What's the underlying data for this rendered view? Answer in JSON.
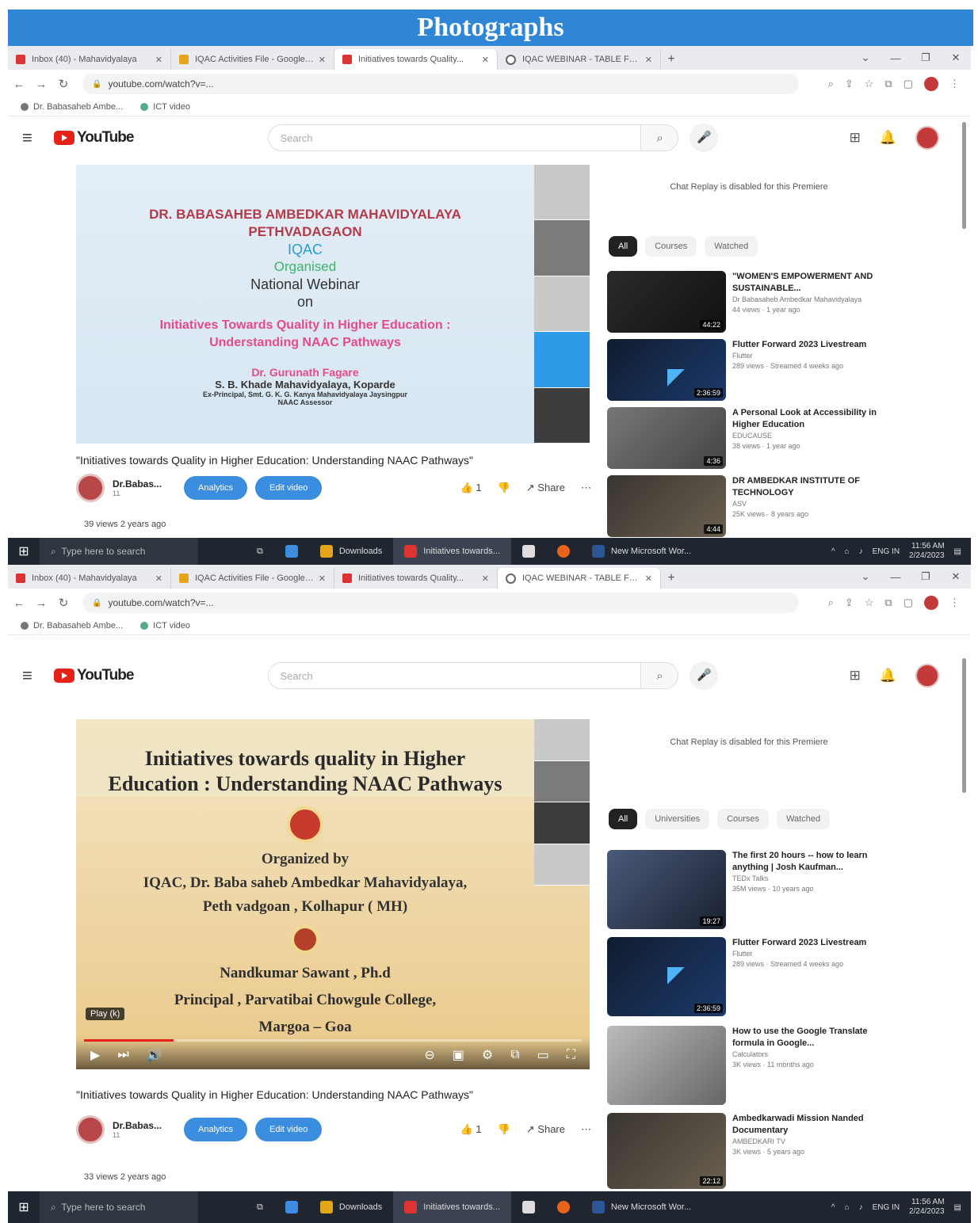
{
  "banner": "Photographs",
  "shot1": {
    "tabs": [
      {
        "label": "Inbox (40) - Mahavidyalaya"
      },
      {
        "label": "IQAC Activities File - Google D..."
      },
      {
        "label": "Initiatives towards Quality..."
      },
      {
        "label": "IQAC WEBINAR - TABLE FOR..."
      }
    ],
    "url": "youtube.com/watch?v=...",
    "bookmarks": [
      "Dr. Babasaheb Ambe...",
      "ICT video"
    ],
    "search_placeholder": "Search",
    "slide": {
      "institution_l1": "DR. BABASAHEB AMBEDKAR MAHAVIDYALAYA",
      "institution_l2": "PETHVADAGAON",
      "iqac": "IQAC",
      "organised": "Organised",
      "webinar": "National Webinar",
      "on": "on",
      "topic_l1": "Initiatives Towards Quality in Higher Education :",
      "topic_l2": "Understanding NAAC Pathways",
      "speaker": "Dr. Gurunath Fagare",
      "college": "S. B. Khade Mahavidyalaya, Koparde",
      "ex_principal": "Ex-Principal, Smt. G. K. G. Kanya Mahavidyalaya Jaysingpur",
      "assessor": "NAAC Assessor"
    },
    "video_title": "\"Initiatives towards Quality in Higher Education: Understanding NAAC Pathways\"",
    "channel": {
      "name": "Dr.Babas...",
      "subs": "11"
    },
    "buttons": {
      "analytics": "Analytics",
      "edit": "Edit video",
      "likes": "1",
      "share": "Share"
    },
    "views": "39 views  2 years ago",
    "chat_note": "Chat Replay is disabled for this Premiere",
    "chips": [
      "All",
      "Courses",
      "Watched"
    ],
    "recs": [
      {
        "title": "\"WOMEN'S EMPOWERMENT AND SUSTAINABLE...",
        "channel": "Dr Babasaheb Ambedkar Mahavidyalaya",
        "meta": "44 views · 1 year ago",
        "duration": "44:22"
      },
      {
        "title": "Flutter Forward 2023 Livestream",
        "channel": "Flutter",
        "meta": "289 views · Streamed 4 weeks ago",
        "duration": "2:36:59"
      },
      {
        "title": "A Personal Look at Accessibility in Higher Education",
        "channel": "EDUCAUSE",
        "meta": "38 views · 1 year ago",
        "duration": "4:36"
      },
      {
        "title": "DR AMBEDKAR INSTITUTE OF TECHNOLOGY",
        "channel": "ASV",
        "meta": "25K views · 8 years ago",
        "duration": "4:44"
      }
    ],
    "taskbar": {
      "search": "Type here to search",
      "apps": [
        "Downloads",
        "Initiatives towards...",
        "New Microsoft Wor..."
      ],
      "lang": "ENG IN",
      "time": "11:56 AM",
      "date": "2/24/2023"
    }
  },
  "shot2": {
    "tabs": [
      {
        "label": "Inbox (40) - Mahavidyalaya"
      },
      {
        "label": "IQAC Activities File - Google D..."
      },
      {
        "label": "Initiatives towards Quality..."
      },
      {
        "label": "IQAC WEBINAR - TABLE FOR..."
      }
    ],
    "url": "youtube.com/watch?v=...",
    "bookmarks": [
      "Dr. Babasaheb Ambe...",
      "ICT video"
    ],
    "search_placeholder": "Search",
    "slide": {
      "title_l1": "Initiatives towards quality in Higher",
      "title_l2": "Education : Understanding NAAC Pathways",
      "organized_by": "Organized by",
      "org_l1": "IQAC, Dr. Baba saheb Ambedkar Mahavidyalaya,",
      "org_l2": "Peth vadgoan , Kolhapur ( MH)",
      "speaker": "Nandkumar Sawant , Ph.d",
      "designation": "Principal , Parvatibai Chowgule College,",
      "place": "Margoa – Goa"
    },
    "player": {
      "chip": "Play (k)",
      "progress": 0.18
    },
    "video_title": "\"Initiatives towards Quality in Higher Education: Understanding NAAC Pathways\"",
    "channel": {
      "name": "Dr.Babas...",
      "subs": "11"
    },
    "buttons": {
      "analytics": "Analytics",
      "edit": "Edit video",
      "likes": "1",
      "share": "Share"
    },
    "views": "33 views  2 years ago",
    "chat_note": "Chat Replay is disabled for this Premiere",
    "chips": [
      "All",
      "Universities",
      "Courses",
      "Watched"
    ],
    "recs": [
      {
        "title": "The first 20 hours -- how to learn anything | Josh Kaufman...",
        "channel": "TEDx Talks",
        "meta": "35M views · 10 years ago",
        "duration": "19:27"
      },
      {
        "title": "Flutter Forward 2023 Livestream",
        "channel": "Flutter",
        "meta": "289 views · Streamed 4 weeks ago",
        "duration": "2:36:59"
      },
      {
        "title": "How to use the Google Translate formula in Google...",
        "channel": "Calculators",
        "meta": "3K views · 11 months ago",
        "duration": ""
      },
      {
        "title": "Ambedkarwadi Mission Nanded Documentary",
        "channel": "AMBEDKARI TV",
        "meta": "3K views · 5 years ago",
        "duration": "22:12"
      }
    ],
    "taskbar": {
      "search": "Type here to search",
      "apps": [
        "Downloads",
        "Initiatives towards...",
        "New Microsoft Wor..."
      ],
      "lang": "ENG IN",
      "time": "11:56 AM",
      "date": "2/24/2023"
    }
  }
}
